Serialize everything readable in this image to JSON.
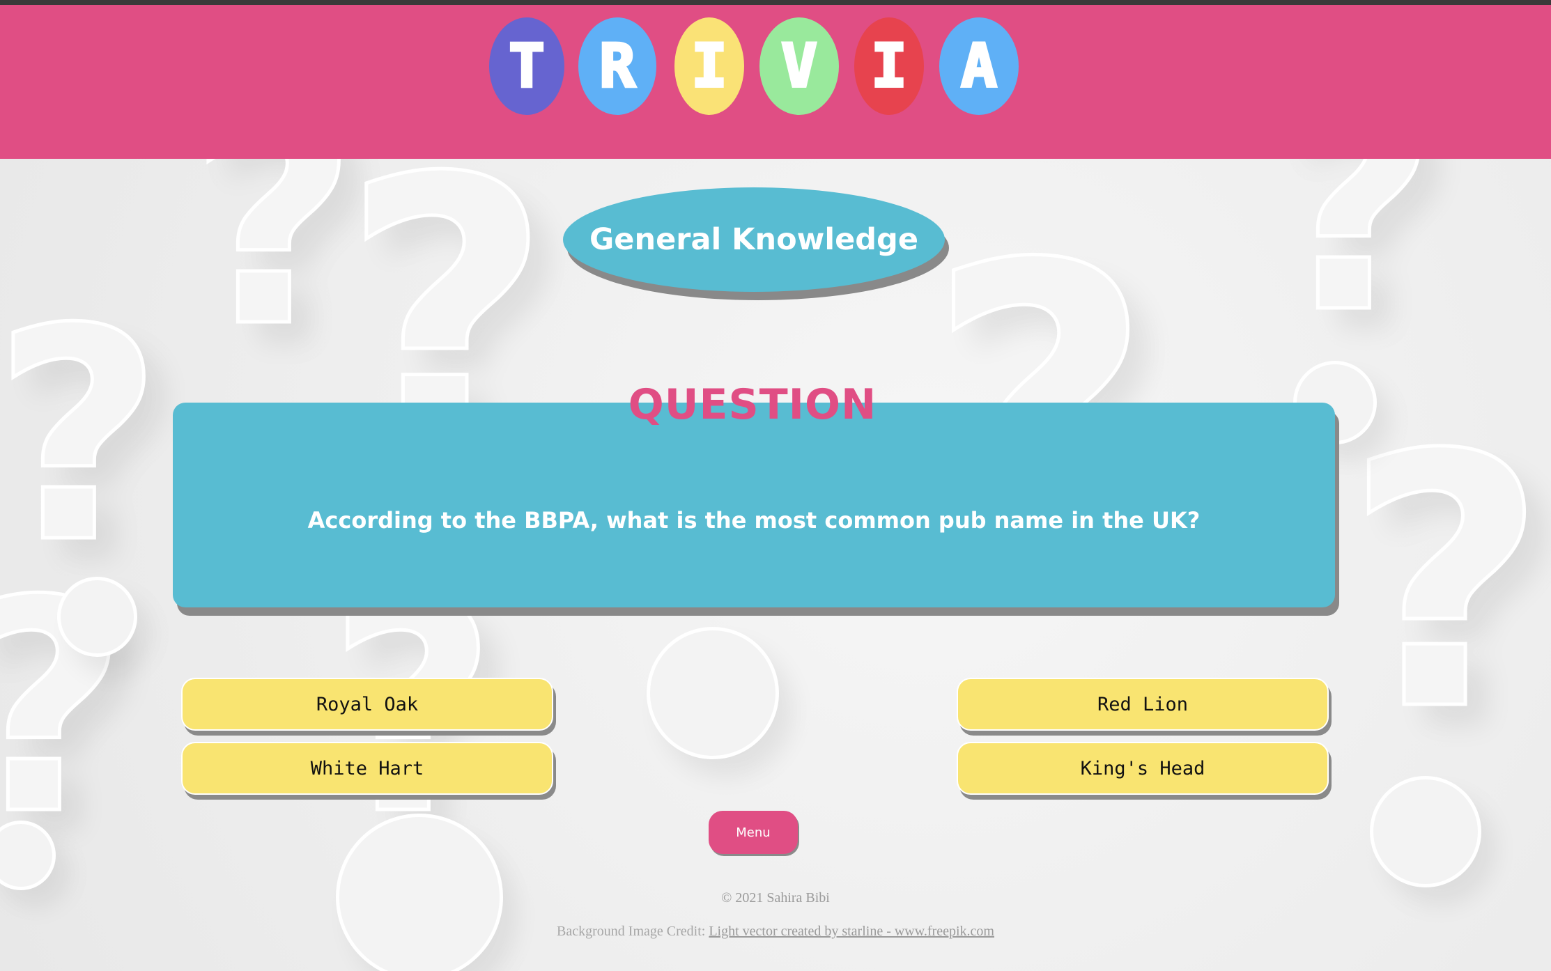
{
  "header": {
    "letters": [
      {
        "char": "T",
        "color": "#6664d0"
      },
      {
        "char": "R",
        "color": "#5fb0f6"
      },
      {
        "char": "I",
        "color": "#fae276"
      },
      {
        "char": "V",
        "color": "#99e99c"
      },
      {
        "char": "I",
        "color": "#e7434e"
      },
      {
        "char": "A",
        "color": "#5fb0f6"
      }
    ]
  },
  "category": "General Knowledge",
  "question": {
    "label": "QUESTION",
    "text": "According to the BBPA, what is the most common pub name in the UK?"
  },
  "answers": [
    "Royal Oak",
    "Red Lion",
    "White Hart",
    "King's Head"
  ],
  "menu_label": "Menu",
  "footer": {
    "copyright": "© 2021 Sahira Bibi",
    "credit_prefix": "Background Image Credit: ",
    "credit_link": "Light vector created by starline - www.freepik.com"
  },
  "colors": {
    "header": "#e04e84",
    "card": "#58bcd2",
    "answer": "#f9e471",
    "button": "#e04e84"
  }
}
